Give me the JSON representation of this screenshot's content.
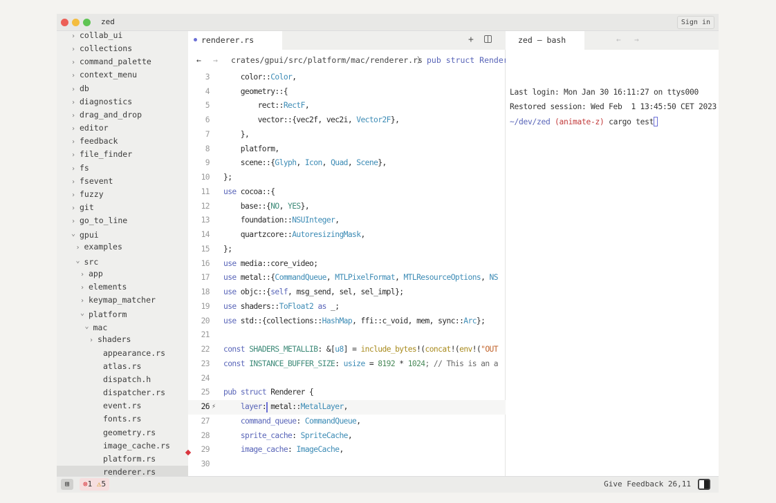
{
  "window": {
    "title": "zed",
    "sign_in": "Sign in"
  },
  "sidebar": {
    "items": [
      {
        "label": "collab_ui",
        "level": 0,
        "kind": "closed"
      },
      {
        "label": "collections",
        "level": 0,
        "kind": "closed"
      },
      {
        "label": "command_palette",
        "level": 0,
        "kind": "closed"
      },
      {
        "label": "context_menu",
        "level": 0,
        "kind": "closed"
      },
      {
        "label": "db",
        "level": 0,
        "kind": "closed"
      },
      {
        "label": "diagnostics",
        "level": 0,
        "kind": "closed"
      },
      {
        "label": "drag_and_drop",
        "level": 0,
        "kind": "closed"
      },
      {
        "label": "editor",
        "level": 0,
        "kind": "closed"
      },
      {
        "label": "feedback",
        "level": 0,
        "kind": "closed"
      },
      {
        "label": "file_finder",
        "level": 0,
        "kind": "closed"
      },
      {
        "label": "fs",
        "level": 0,
        "kind": "closed"
      },
      {
        "label": "fsevent",
        "level": 0,
        "kind": "closed"
      },
      {
        "label": "fuzzy",
        "level": 0,
        "kind": "closed"
      },
      {
        "label": "git",
        "level": 0,
        "kind": "closed"
      },
      {
        "label": "go_to_line",
        "level": 0,
        "kind": "closed"
      },
      {
        "label": "gpui",
        "level": 0,
        "kind": "open"
      },
      {
        "label": "examples",
        "level": 1,
        "kind": "closed"
      },
      {
        "label": "src",
        "level": 1,
        "kind": "open"
      },
      {
        "label": "app",
        "level": 2,
        "kind": "closed"
      },
      {
        "label": "elements",
        "level": 2,
        "kind": "closed"
      },
      {
        "label": "keymap_matcher",
        "level": 2,
        "kind": "closed"
      },
      {
        "label": "platform",
        "level": 2,
        "kind": "open"
      },
      {
        "label": "mac",
        "level": 3,
        "kind": "open"
      },
      {
        "label": "shaders",
        "level": 4,
        "kind": "closed"
      },
      {
        "label": "appearance.rs",
        "level": 4,
        "kind": "file"
      },
      {
        "label": "atlas.rs",
        "level": 4,
        "kind": "file"
      },
      {
        "label": "dispatch.h",
        "level": 4,
        "kind": "file"
      },
      {
        "label": "dispatcher.rs",
        "level": 4,
        "kind": "file"
      },
      {
        "label": "event.rs",
        "level": 4,
        "kind": "file"
      },
      {
        "label": "fonts.rs",
        "level": 4,
        "kind": "file"
      },
      {
        "label": "geometry.rs",
        "level": 4,
        "kind": "file"
      },
      {
        "label": "image_cache.rs",
        "level": 4,
        "kind": "file"
      },
      {
        "label": "platform.rs",
        "level": 4,
        "kind": "file"
      },
      {
        "label": "renderer.rs",
        "level": 4,
        "kind": "file",
        "selected": true
      }
    ]
  },
  "editor": {
    "tab": "renderer.rs",
    "breadcrumb_path": "crates/gpui/src/platform/mac/renderer.rs",
    "breadcrumb_symbol": "pub struct Render",
    "current_line": 26,
    "lines": [
      {
        "n": "3",
        "t": [
          [
            "    color::",
            "pl"
          ],
          [
            "Color",
            "ty"
          ],
          [
            ",",
            "pl"
          ]
        ]
      },
      {
        "n": "4",
        "t": [
          [
            "    geometry::{",
            "pl"
          ]
        ]
      },
      {
        "n": "5",
        "t": [
          [
            "        rect::",
            "pl"
          ],
          [
            "RectF",
            "ty"
          ],
          [
            ",",
            "pl"
          ]
        ]
      },
      {
        "n": "6",
        "t": [
          [
            "        vector::{vec2f, vec2i, ",
            "pl"
          ],
          [
            "Vector2F",
            "ty"
          ],
          [
            "},",
            "pl"
          ]
        ]
      },
      {
        "n": "7",
        "t": [
          [
            "    },",
            "pl"
          ]
        ]
      },
      {
        "n": "8",
        "t": [
          [
            "    platform,",
            "pl"
          ]
        ]
      },
      {
        "n": "9",
        "t": [
          [
            "    scene::{",
            "pl"
          ],
          [
            "Glyph",
            "ty"
          ],
          [
            ", ",
            "pl"
          ],
          [
            "Icon",
            "ty"
          ],
          [
            ", ",
            "pl"
          ],
          [
            "Quad",
            "ty"
          ],
          [
            ", ",
            "pl"
          ],
          [
            "Scene",
            "ty"
          ],
          [
            "},",
            "pl"
          ]
        ]
      },
      {
        "n": "10",
        "t": [
          [
            "};",
            "pl"
          ]
        ]
      },
      {
        "n": "11",
        "t": [
          [
            "use",
            "kw"
          ],
          [
            " cocoa::{",
            "pl"
          ]
        ]
      },
      {
        "n": "12",
        "t": [
          [
            "    base::{",
            "pl"
          ],
          [
            "NO",
            "cn"
          ],
          [
            ", ",
            "pl"
          ],
          [
            "YES",
            "cn"
          ],
          [
            "},",
            "pl"
          ]
        ]
      },
      {
        "n": "13",
        "t": [
          [
            "    foundation::",
            "pl"
          ],
          [
            "NSUInteger",
            "ty"
          ],
          [
            ",",
            "pl"
          ]
        ]
      },
      {
        "n": "14",
        "t": [
          [
            "    quartzcore::",
            "pl"
          ],
          [
            "AutoresizingMask",
            "ty"
          ],
          [
            ",",
            "pl"
          ]
        ]
      },
      {
        "n": "15",
        "t": [
          [
            "};",
            "pl"
          ]
        ]
      },
      {
        "n": "16",
        "t": [
          [
            "use",
            "kw"
          ],
          [
            " media::core_video;",
            "pl"
          ]
        ]
      },
      {
        "n": "17",
        "t": [
          [
            "use",
            "kw"
          ],
          [
            " metal::{",
            "pl"
          ],
          [
            "CommandQueue",
            "ty"
          ],
          [
            ", ",
            "pl"
          ],
          [
            "MTLPixelFormat",
            "ty"
          ],
          [
            ", ",
            "pl"
          ],
          [
            "MTLResourceOptions",
            "ty"
          ],
          [
            ", ",
            "pl"
          ],
          [
            "NS",
            "ty"
          ]
        ]
      },
      {
        "n": "18",
        "t": [
          [
            "use",
            "kw"
          ],
          [
            " objc::{",
            "pl"
          ],
          [
            "self",
            "kw"
          ],
          [
            ", msg_send, sel, sel_impl};",
            "pl"
          ]
        ]
      },
      {
        "n": "19",
        "t": [
          [
            "use",
            "kw"
          ],
          [
            " shaders::",
            "pl"
          ],
          [
            "ToFloat2",
            "ty"
          ],
          [
            " ",
            "pl"
          ],
          [
            "as",
            "kw"
          ],
          [
            " _;",
            "pl"
          ]
        ]
      },
      {
        "n": "20",
        "t": [
          [
            "use",
            "kw"
          ],
          [
            " std::{collections::",
            "pl"
          ],
          [
            "HashMap",
            "ty"
          ],
          [
            ", ffi::c_void, mem, sync::",
            "pl"
          ],
          [
            "Arc",
            "ty"
          ],
          [
            "};",
            "pl"
          ]
        ]
      },
      {
        "n": "21",
        "t": []
      },
      {
        "n": "22",
        "t": [
          [
            "const",
            "kw"
          ],
          [
            " SHADERS_METALLIB",
            "cn"
          ],
          [
            ": &[",
            "pl"
          ],
          [
            "u8",
            "ty"
          ],
          [
            "] = ",
            "pl"
          ],
          [
            "include_bytes",
            "fn"
          ],
          [
            "!(",
            "pl"
          ],
          [
            "concat",
            "fn"
          ],
          [
            "!(",
            "pl"
          ],
          [
            "env",
            "fn"
          ],
          [
            "!(",
            "pl"
          ],
          [
            "\"OUT",
            "st"
          ]
        ]
      },
      {
        "n": "23",
        "t": [
          [
            "const",
            "kw"
          ],
          [
            " INSTANCE_BUFFER_SIZE",
            "cn"
          ],
          [
            ": ",
            "pl"
          ],
          [
            "usize",
            "ty"
          ],
          [
            " = ",
            "pl"
          ],
          [
            "8192",
            "nu"
          ],
          [
            " * ",
            "pl"
          ],
          [
            "1024",
            "nu"
          ],
          [
            "; // This is an a",
            "cm"
          ]
        ]
      },
      {
        "n": "24",
        "t": []
      },
      {
        "n": "25",
        "t": [
          [
            "pub",
            "kw"
          ],
          [
            " ",
            "pl"
          ],
          [
            "struct",
            "kw"
          ],
          [
            " Renderer {",
            "pl"
          ]
        ]
      },
      {
        "n": "26",
        "t": [
          [
            "    ",
            "pl"
          ],
          [
            "layer",
            "kw"
          ],
          [
            ": metal::",
            "pl"
          ],
          [
            "MetalLayer",
            "ty"
          ],
          [
            ",",
            "pl"
          ]
        ]
      },
      {
        "n": "27",
        "t": [
          [
            "    ",
            "pl"
          ],
          [
            "command_queue",
            "kw"
          ],
          [
            ": ",
            "pl"
          ],
          [
            "CommandQueue",
            "ty"
          ],
          [
            ",",
            "pl"
          ]
        ]
      },
      {
        "n": "28",
        "t": [
          [
            "    ",
            "pl"
          ],
          [
            "sprite_cache",
            "kw"
          ],
          [
            ": ",
            "pl"
          ],
          [
            "SpriteCache",
            "ty"
          ],
          [
            ",",
            "pl"
          ]
        ]
      },
      {
        "n": "29",
        "t": [
          [
            "    ",
            "pl"
          ],
          [
            "image_cache",
            "kw"
          ],
          [
            ": ",
            "pl"
          ],
          [
            "ImageCache",
            "ty"
          ],
          [
            ",",
            "pl"
          ]
        ]
      },
      {
        "n": "30",
        "t": []
      }
    ]
  },
  "terminal": {
    "tab": "zed — bash",
    "lines": [
      "Last login: Mon Jan 30 16:11:27 on ttys000",
      "Restored session: Wed Feb  1 13:45:50 CET 2023"
    ],
    "prompt_dir": "~/dev/zed",
    "prompt_branch": "(animate-z)",
    "command": "cargo test"
  },
  "status": {
    "errors": "1",
    "warnings": "5",
    "feedback": "Give Feedback",
    "cursor": "26,11"
  },
  "colors": {
    "close": "#ec5f57",
    "minimize": "#f4bd3f",
    "maximize": "#5fc453",
    "accent": "#6b6fd6",
    "error": "#d9363e",
    "warning": "#d69a1c"
  }
}
